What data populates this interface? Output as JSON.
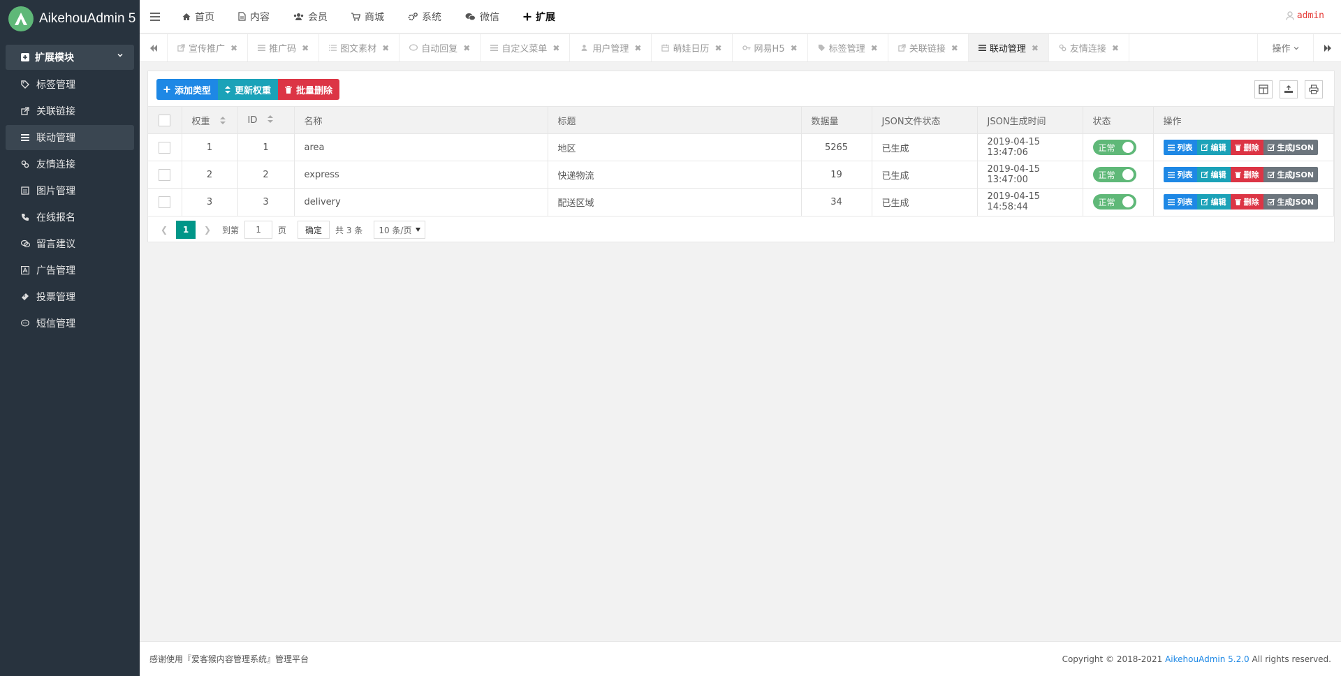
{
  "brand": {
    "name": "AikehouAdmin 5"
  },
  "sidebar": {
    "group_label": "扩展模块",
    "items": [
      {
        "label": "标签管理",
        "icon": "tag-icon"
      },
      {
        "label": "关联链接",
        "icon": "external-link-icon"
      },
      {
        "label": "联动管理",
        "icon": "list-icon",
        "active": true
      },
      {
        "label": "友情连接",
        "icon": "link-icon"
      },
      {
        "label": "图片管理",
        "icon": "image-icon"
      },
      {
        "label": "在线报名",
        "icon": "phone-icon"
      },
      {
        "label": "留言建议",
        "icon": "comments-icon"
      },
      {
        "label": "广告管理",
        "icon": "ad-icon"
      },
      {
        "label": "投票管理",
        "icon": "ticket-icon"
      },
      {
        "label": "短信管理",
        "icon": "sms-icon"
      }
    ]
  },
  "topnav": {
    "items": [
      {
        "label": "首页",
        "icon": "home-icon"
      },
      {
        "label": "内容",
        "icon": "file-icon"
      },
      {
        "label": "会员",
        "icon": "users-icon"
      },
      {
        "label": "商城",
        "icon": "cart-icon"
      },
      {
        "label": "系统",
        "icon": "gears-icon"
      },
      {
        "label": "微信",
        "icon": "wechat-icon"
      },
      {
        "label": "扩展",
        "icon": "plus-icon",
        "active": true
      }
    ],
    "user": "admin"
  },
  "tabs": {
    "items": [
      {
        "label": "宣传推广",
        "icon": "external-link-icon"
      },
      {
        "label": "推广码",
        "icon": "list-icon"
      },
      {
        "label": "图文素材",
        "icon": "list-icon"
      },
      {
        "label": "自动回复",
        "icon": "comment-icon"
      },
      {
        "label": "自定义菜单",
        "icon": "list-icon"
      },
      {
        "label": "用户管理",
        "icon": "users-icon"
      },
      {
        "label": "萌娃日历",
        "icon": "calendar-icon"
      },
      {
        "label": "网易H5",
        "icon": "key-icon"
      },
      {
        "label": "标签管理",
        "icon": "tag-icon"
      },
      {
        "label": "关联链接",
        "icon": "external-link-icon"
      },
      {
        "label": "联动管理",
        "icon": "list-icon",
        "active": true
      },
      {
        "label": "友情连接",
        "icon": "link-icon"
      }
    ],
    "ops_label": "操作"
  },
  "toolbar": {
    "add_label": "添加类型",
    "update_label": "更新权重",
    "delete_label": "批量删除"
  },
  "table": {
    "headers": {
      "weight": "权重",
      "id": "ID",
      "name": "名称",
      "title": "标题",
      "count": "数据量",
      "json_status": "JSON文件状态",
      "json_time": "JSON生成时间",
      "status": "状态",
      "ops": "操作"
    },
    "rows": [
      {
        "weight": "1",
        "id": "1",
        "name": "area",
        "title": "地区",
        "count": "5265",
        "json_status": "已生成",
        "json_time": "2019-04-15 13:47:06",
        "status": "正常"
      },
      {
        "weight": "2",
        "id": "2",
        "name": "express",
        "title": "快递物流",
        "count": "19",
        "json_status": "已生成",
        "json_time": "2019-04-15 13:47:00",
        "status": "正常"
      },
      {
        "weight": "3",
        "id": "3",
        "name": "delivery",
        "title": "配送区域",
        "count": "34",
        "json_status": "已生成",
        "json_time": "2019-04-15 14:58:44",
        "status": "正常"
      }
    ],
    "op_labels": {
      "list": "列表",
      "edit": "编辑",
      "delete": "删除",
      "gen": "生成JSON"
    }
  },
  "pager": {
    "current": "1",
    "goto_label": "到第",
    "page_input": "1",
    "page_unit": "页",
    "confirm": "确定",
    "total": "共 3 条",
    "per_page": "10 条/页"
  },
  "footer": {
    "left": "感谢使用『爱客猴内容管理系统』管理平台",
    "copyright": "Copyright © 2018-2021",
    "version_link": "AikehouAdmin 5.2.0",
    "rights": "All rights reserved."
  },
  "colors": {
    "sidebar_bg": "#28333e",
    "accent_green": "#5fb878",
    "primary_blue": "#1e88e5",
    "teal": "#1ba2b8",
    "danger_red": "#dc3545",
    "pager_active": "#009688"
  }
}
